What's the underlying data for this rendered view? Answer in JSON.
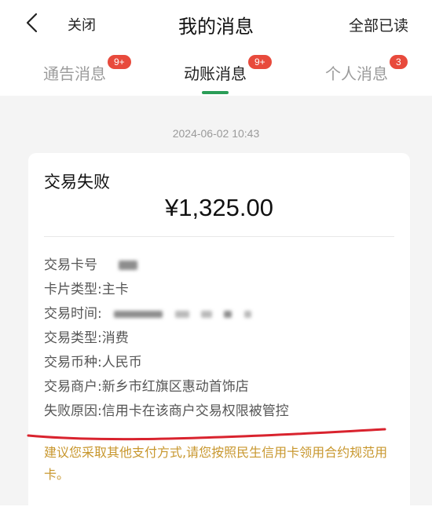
{
  "header": {
    "close_label": "关闭",
    "title": "我的消息",
    "read_all_label": "全部已读"
  },
  "tabs": [
    {
      "label": "通告消息",
      "badge": "9+",
      "active": false
    },
    {
      "label": "动账消息",
      "badge": "9+",
      "active": true
    },
    {
      "label": "个人消息",
      "badge": "3",
      "active": false
    }
  ],
  "message": {
    "timestamp": "2024-06-02 10:43",
    "title": "交易失败",
    "amount": "¥1,325.00",
    "rows": [
      {
        "key": "交易卡号",
        "value": ""
      },
      {
        "key": "卡片类型:",
        "value": "主卡"
      },
      {
        "key": "交易时间:",
        "value": ""
      },
      {
        "key": "交易类型:",
        "value": "消费"
      },
      {
        "key": "交易币种:",
        "value": "人民币"
      },
      {
        "key": "交易商户:",
        "value": "新乡市红旗区惠动首饰店"
      },
      {
        "key": "失败原因:",
        "value": "信用卡在该商户交易权限被管控"
      }
    ],
    "advice": "建议您采取其他支付方式,请您按照民生信用卡领用合约规范用卡。"
  },
  "colors": {
    "accent_green": "#2a9d57",
    "badge_red": "#e84a3c",
    "advice_orange": "#c8972e",
    "annotation_red": "#d9232e"
  }
}
